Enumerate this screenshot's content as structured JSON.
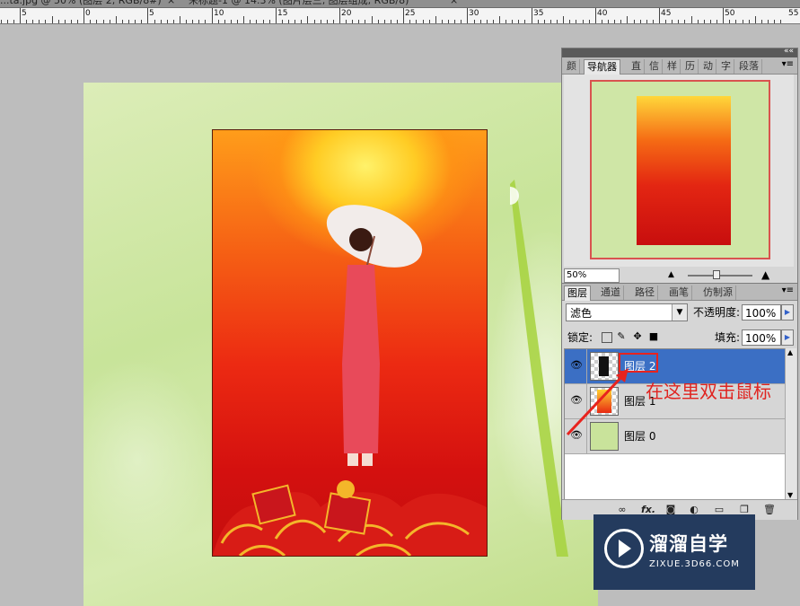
{
  "doc_tabs": [
    {
      "label": "...ta.jpg @ 50% (图层 2, RGB/8#)",
      "close": "×"
    },
    {
      "label": "未标题-1 @ 14.3% (图片层三, 图层组成, RGB/8)",
      "close": "×"
    }
  ],
  "ruler_numbers": [
    "5",
    "0",
    "5",
    "10",
    "15",
    "20",
    "25",
    "30",
    "35",
    "40",
    "45",
    "50",
    "55"
  ],
  "navigator_panel": {
    "collapse_icon": "««",
    "tabs": [
      "颜",
      "导航器",
      "直",
      "信",
      "样",
      "历",
      "动",
      "字",
      "段落"
    ],
    "active_tab": "导航器",
    "zoom_value": "50%"
  },
  "layers_panel": {
    "tabs": [
      "图层",
      "通道",
      "路径",
      "画笔",
      "仿制源"
    ],
    "blend_mode": "滤色",
    "opacity_label": "不透明度:",
    "opacity_value": "100%",
    "lock_label": "锁定:",
    "fill_label": "填充:",
    "fill_value": "100%",
    "layers": [
      {
        "name": "图层 2",
        "selected": true,
        "visible": true
      },
      {
        "name": "图层 1",
        "selected": false,
        "visible": true
      },
      {
        "name": "图层 0",
        "selected": false,
        "visible": true
      }
    ],
    "bottom_icons": [
      "link-icon",
      "fx-icon",
      "mask-icon",
      "adjustment-icon",
      "group-icon",
      "new-layer-icon",
      "trash-icon"
    ],
    "fx_label": "fx."
  },
  "annotation": {
    "text": "在这里双击鼠标",
    "color": "#e02420"
  },
  "watermark": {
    "title": "溜溜自学",
    "subtitle": "ZIXUE.3D66.COM"
  }
}
